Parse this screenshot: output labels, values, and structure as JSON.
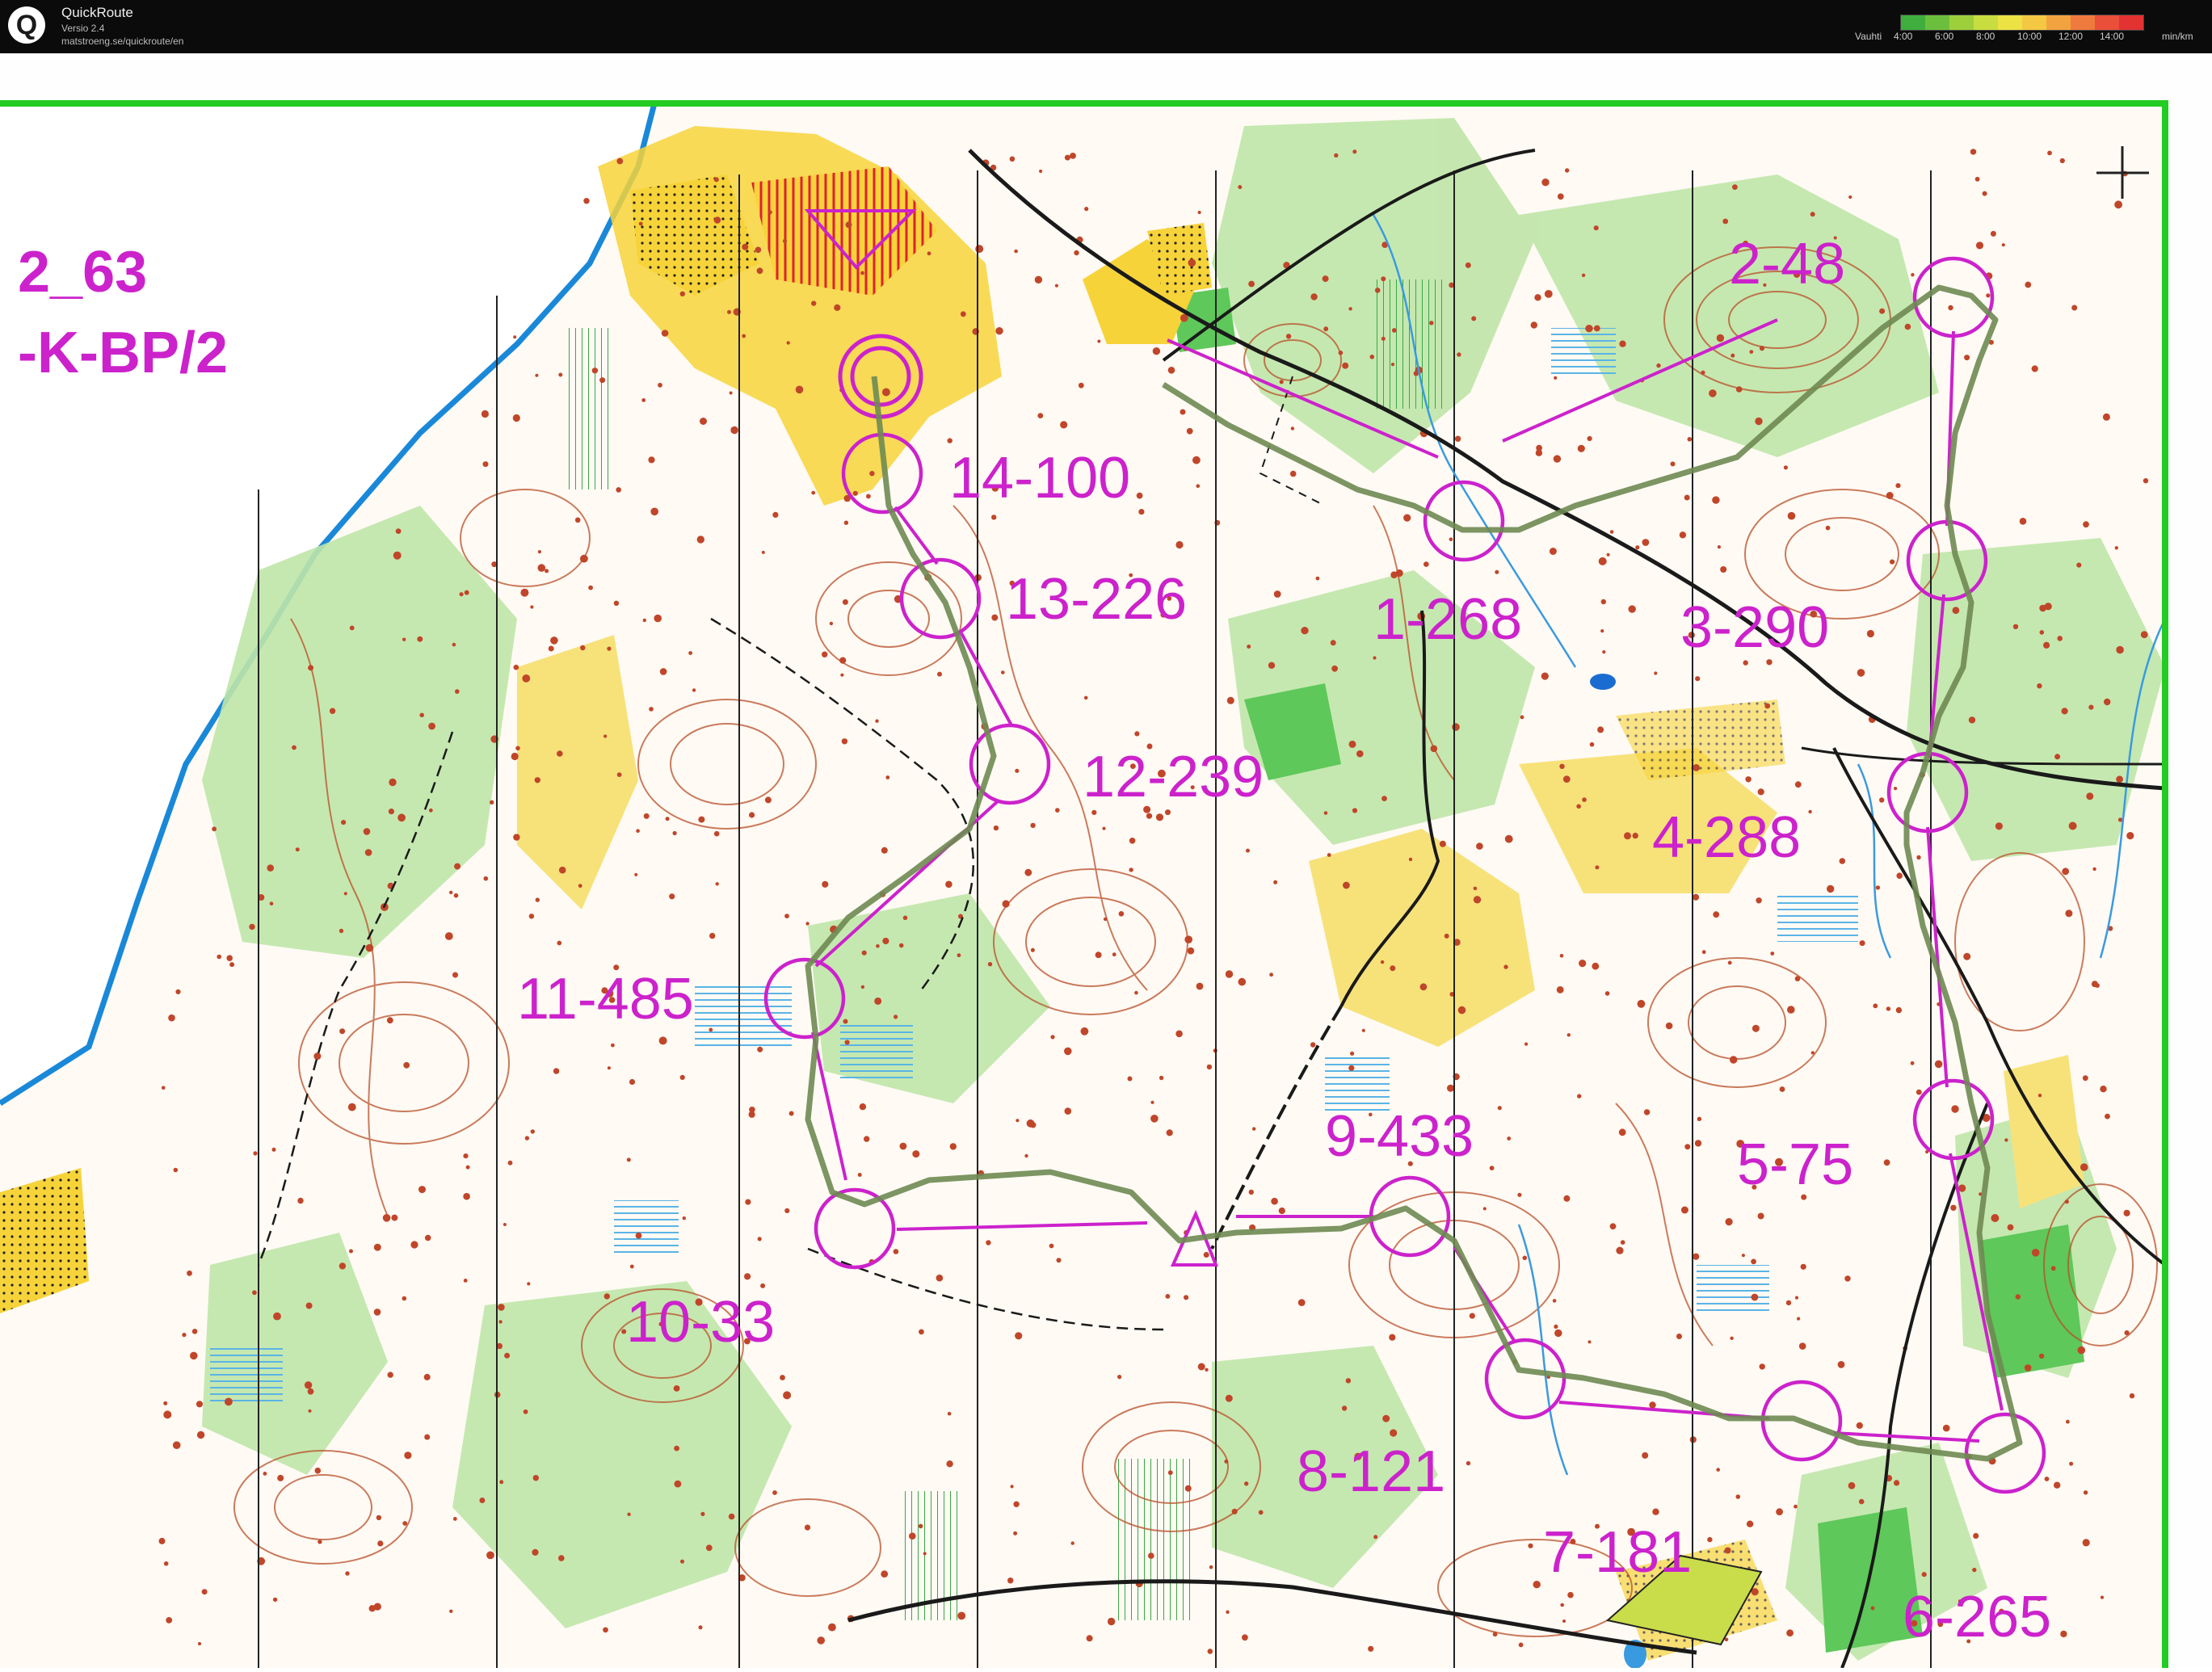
{
  "app": {
    "name": "QuickRoute",
    "version": "Versio 2.4",
    "url": "matstroeng.se/quickroute/en",
    "logo_letter": "Q"
  },
  "pace_legend": {
    "label": "Vauhti",
    "ticks": [
      "4:00",
      "6:00",
      "8:00",
      "10:00",
      "12:00",
      "14:00"
    ],
    "unit": "min/km",
    "colors": [
      "#3fae3f",
      "#6cbf3c",
      "#9dcf3d",
      "#c8dd3f",
      "#ece244",
      "#f4c842",
      "#f2a33f",
      "#ef7a3d",
      "#ea4f3a",
      "#e23232"
    ]
  },
  "map": {
    "course_title_line1": "2_63",
    "course_title_line2": "-K-BP/2",
    "control_labels": [
      "1-268",
      "2-48",
      "3-290",
      "4-288",
      "5-75",
      "6-265",
      "7-181",
      "8-121",
      "9-433",
      "10-33",
      "11-485",
      "12-239",
      "13-226",
      "14-100"
    ],
    "colors": {
      "course": "#cc22cc",
      "route": "#6e8a52",
      "contour": "#b8502a",
      "water": "#3a9ae0",
      "vegetation": "#bfe6a8",
      "open_land": "#f7d33a",
      "border": "#22cc22"
    }
  }
}
